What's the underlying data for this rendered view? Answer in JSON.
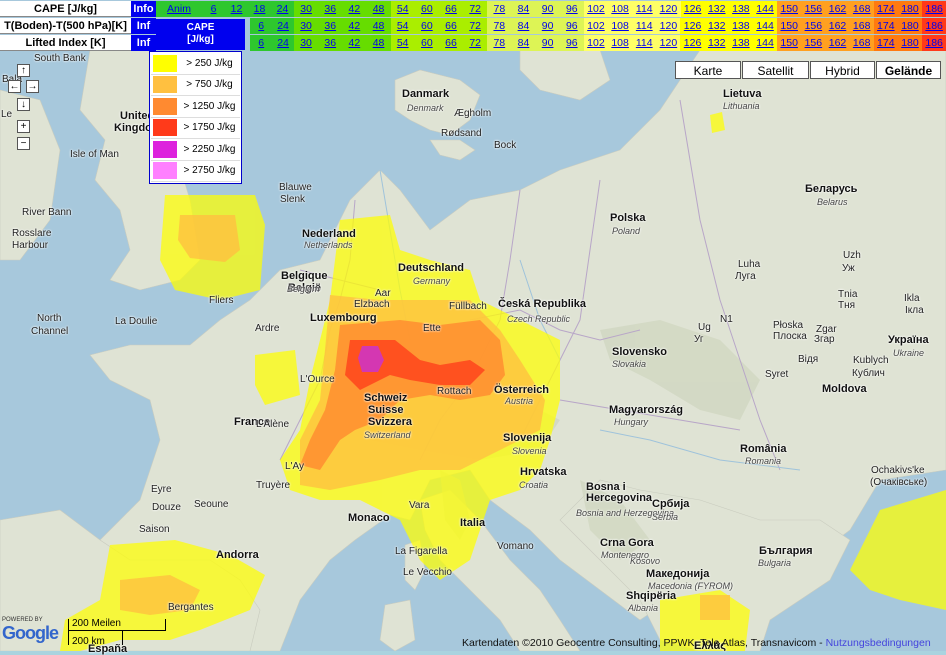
{
  "table": {
    "rows": [
      {
        "name": "CAPE [J/kg]",
        "info": "Info"
      },
      {
        "name": "T(Boden)-T(500 hPa)[K]",
        "info": "Inf"
      },
      {
        "name": "Lifted Index [K]",
        "info": "Inf"
      }
    ],
    "anim_label": "Anim",
    "row1_first": [
      "6",
      "12",
      "18",
      "24"
    ],
    "row23_first": [
      "6",
      "24"
    ],
    "hours": [
      "30",
      "36",
      "42",
      "48",
      "54",
      "60",
      "66",
      "72",
      "78",
      "84",
      "90",
      "96",
      "102",
      "108",
      "114",
      "120",
      "126",
      "132",
      "138",
      "144",
      "150",
      "156",
      "162",
      "168",
      "174",
      "180",
      "186"
    ],
    "colors": {
      "green_dark": "#2ec72e",
      "green": "#66dd00",
      "lime": "#aaee00",
      "yellow_green": "#ddf455",
      "light_yellow": "#ffff66",
      "yellow": "#ffff00",
      "orange_light": "#ffa020",
      "orange": "#ff7a10",
      "red": "#ff3a1a"
    }
  },
  "cape_box": {
    "line1": "CAPE",
    "line2": "[J/kg]"
  },
  "legend": [
    {
      "label": "> 250 J/kg",
      "color": "#ffff00"
    },
    {
      "label": "> 750 J/kg",
      "color": "#ffc040"
    },
    {
      "label": "> 1250 J/kg",
      "color": "#ff8a30"
    },
    {
      "label": "> 1750 J/kg",
      "color": "#ff3a1a"
    },
    {
      "label": "> 2250 J/kg",
      "color": "#dd22dd"
    },
    {
      "label": "> 2750 J/kg",
      "color": "#ff80ff"
    }
  ],
  "map_types": [
    "Karte",
    "Satellit",
    "Hybrid",
    "Gelände"
  ],
  "scale": {
    "miles": "200 Meilen",
    "km": "200 km"
  },
  "attribution": {
    "text": "Kartendaten ©2010 Geocentre Consulting, PPWK, Tele Atlas, Transnavicom -",
    "link": "Nutzungsbedingungen"
  },
  "google": {
    "powered": "POWERED BY",
    "logo": "Google"
  },
  "labels": {
    "countries": [
      {
        "t": "Danmark"
      },
      {
        "t": "Polska"
      },
      {
        "t": "Deutschland"
      },
      {
        "t": "Nederland"
      },
      {
        "t": "Belgique"
      },
      {
        "t": "België"
      },
      {
        "t": "Luxembourg"
      },
      {
        "t": "France"
      },
      {
        "t": "Schweiz"
      },
      {
        "t": "Suisse"
      },
      {
        "t": "Svizzera"
      },
      {
        "t": "Österreich"
      },
      {
        "t": "Česká Republika"
      },
      {
        "t": "Slovensko"
      },
      {
        "t": "Magyarország"
      },
      {
        "t": "Slovenija"
      },
      {
        "t": "Hrvatska"
      },
      {
        "t": "Italia"
      },
      {
        "t": "România"
      },
      {
        "t": "Беларусь"
      },
      {
        "t": "Україна"
      },
      {
        "t": "Lietuva"
      },
      {
        "t": "Moldova"
      },
      {
        "t": "Србија"
      },
      {
        "t": "Bosna i"
      },
      {
        "t": "Hercegovina"
      },
      {
        "t": "Crna Gora"
      },
      {
        "t": "България"
      },
      {
        "t": "Македонија"
      },
      {
        "t": "Shqipëria"
      },
      {
        "t": "United"
      },
      {
        "t": "Kingdom"
      },
      {
        "t": "España"
      },
      {
        "t": "Andorra"
      },
      {
        "t": "Monaco"
      },
      {
        "t": "Ελλάς"
      }
    ],
    "local": [
      {
        "t": "Denmark"
      },
      {
        "t": "Poland"
      },
      {
        "t": "Germany"
      },
      {
        "t": "Netherlands"
      },
      {
        "t": "Belgium"
      },
      {
        "t": "Czech Republic"
      },
      {
        "t": "Slovakia"
      },
      {
        "t": "Hungary"
      },
      {
        "t": "Switzerland"
      },
      {
        "t": "Austria"
      },
      {
        "t": "Slovenia"
      },
      {
        "t": "Croatia"
      },
      {
        "t": "Romania"
      },
      {
        "t": "Belarus"
      },
      {
        "t": "Ukraine"
      },
      {
        "t": "Lithuania"
      },
      {
        "t": "Bosnia and Herzegovina"
      },
      {
        "t": "Serbia"
      },
      {
        "t": "Montenegro"
      },
      {
        "t": "Kosovo"
      },
      {
        "t": "Bulgaria"
      },
      {
        "t": "Macedonia (FYROM)"
      },
      {
        "t": "Albania"
      }
    ],
    "places": [
      {
        "t": "Ægholm"
      },
      {
        "t": "Rødsand"
      },
      {
        "t": "Bock"
      },
      {
        "t": "Blauwe"
      },
      {
        "t": "Slenk"
      },
      {
        "t": "Fliers"
      },
      {
        "t": "North"
      },
      {
        "t": "Channel"
      },
      {
        "t": "La Doulie"
      },
      {
        "t": "Ardre"
      },
      {
        "t": "L'Ource"
      },
      {
        "t": "L'Alène"
      },
      {
        "t": "L'Ay"
      },
      {
        "t": "Truyère"
      },
      {
        "t": "Eyre"
      },
      {
        "t": "Douze"
      },
      {
        "t": "Seoune"
      },
      {
        "t": "Saison"
      },
      {
        "t": "Bergantes"
      },
      {
        "t": "La Figarella"
      },
      {
        "t": "Le Vecchio"
      },
      {
        "t": "Vomano"
      },
      {
        "t": "Vara"
      },
      {
        "t": "Elzbach"
      },
      {
        "t": "Aar"
      },
      {
        "t": "Ette"
      },
      {
        "t": "Füllbach"
      },
      {
        "t": "Rottach"
      },
      {
        "t": "Ug"
      },
      {
        "t": "Уг"
      },
      {
        "t": "N1"
      },
      {
        "t": "Płoska"
      },
      {
        "t": "Плоска"
      },
      {
        "t": "Zgar"
      },
      {
        "t": "Згар"
      },
      {
        "t": "Відя"
      },
      {
        "t": "Kublych"
      },
      {
        "t": "Кублич"
      },
      {
        "t": "Syret"
      },
      {
        "t": "Ikla"
      },
      {
        "t": "Ікла"
      },
      {
        "t": "Uzh"
      },
      {
        "t": "Уж"
      },
      {
        "t": "Tnia"
      },
      {
        "t": "Тня"
      },
      {
        "t": "Luha"
      },
      {
        "t": "Луга"
      },
      {
        "t": "Ochakivs'ke"
      },
      {
        "t": "(Очаківське)"
      },
      {
        "t": "River Bann"
      },
      {
        "t": "Rosslare"
      },
      {
        "t": "Harbour"
      },
      {
        "t": "Isle of Man"
      },
      {
        "t": "Bala"
      },
      {
        "t": "South Bank"
      },
      {
        "t": "Le"
      }
    ]
  }
}
